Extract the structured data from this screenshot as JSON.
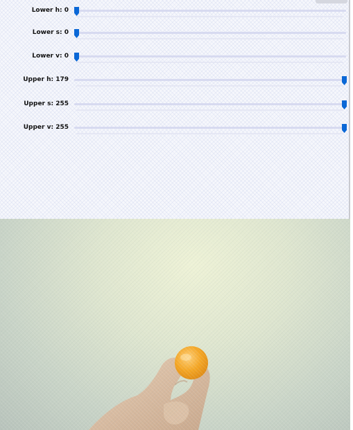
{
  "trackbars": [
    {
      "label": "Lower h: 0",
      "value": 0,
      "max": 179
    },
    {
      "label": "Lower s: 0",
      "value": 0,
      "max": 255
    },
    {
      "label": "Lower v: 0",
      "value": 0,
      "max": 255
    },
    {
      "label": "Upper h: 179",
      "value": 179,
      "max": 179
    },
    {
      "label": "Upper s: 255",
      "value": 255,
      "max": 255
    },
    {
      "label": "Upper v: 255",
      "value": 255,
      "max": 255
    }
  ],
  "colors": {
    "thumb": "#0a67d6",
    "track": "#d7daf0",
    "ball": "#f5a623",
    "skin": "#d7b89a"
  },
  "camera": {
    "subject": "orange-ball-held-in-hand"
  }
}
